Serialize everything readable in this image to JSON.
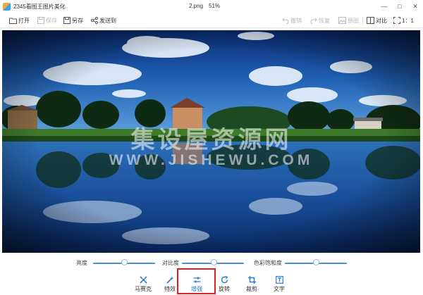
{
  "window": {
    "app_title": "2345看图王图片美化",
    "file_name": "2.png",
    "zoom": "51%",
    "buttons": {
      "minimize": "—",
      "restore": "□",
      "close": "✕"
    }
  },
  "toolbar": {
    "open": "打开",
    "save": "保存",
    "save_as": "另存",
    "send_to": "发送到",
    "undo": "撤销",
    "redo": "恢复",
    "original": "原图",
    "compare": "对比",
    "ratio": "1：1"
  },
  "watermark": {
    "line1": "集设屋资源网",
    "line2": "WWW.JISHEWU.COM"
  },
  "sliders": [
    {
      "label": "亮度",
      "value": 0.5
    },
    {
      "label": "对比度",
      "value": 0.52
    },
    {
      "label": "色彩饱和度",
      "value": 0.5
    }
  ],
  "bottom_tools": [
    {
      "label": "马赛克",
      "icon": "mosaic-icon"
    },
    {
      "label": "特效",
      "icon": "magic-wand-icon"
    },
    {
      "label": "增强",
      "icon": "sliders-icon",
      "active": true
    },
    {
      "label": "旋转",
      "icon": "rotate-icon"
    },
    {
      "label": "裁剪",
      "icon": "crop-icon"
    },
    {
      "label": "文字",
      "icon": "text-icon"
    }
  ],
  "colors": {
    "accent": "#2a7ad6",
    "highlight": "#e02020",
    "slider": "#4a8fe0"
  }
}
